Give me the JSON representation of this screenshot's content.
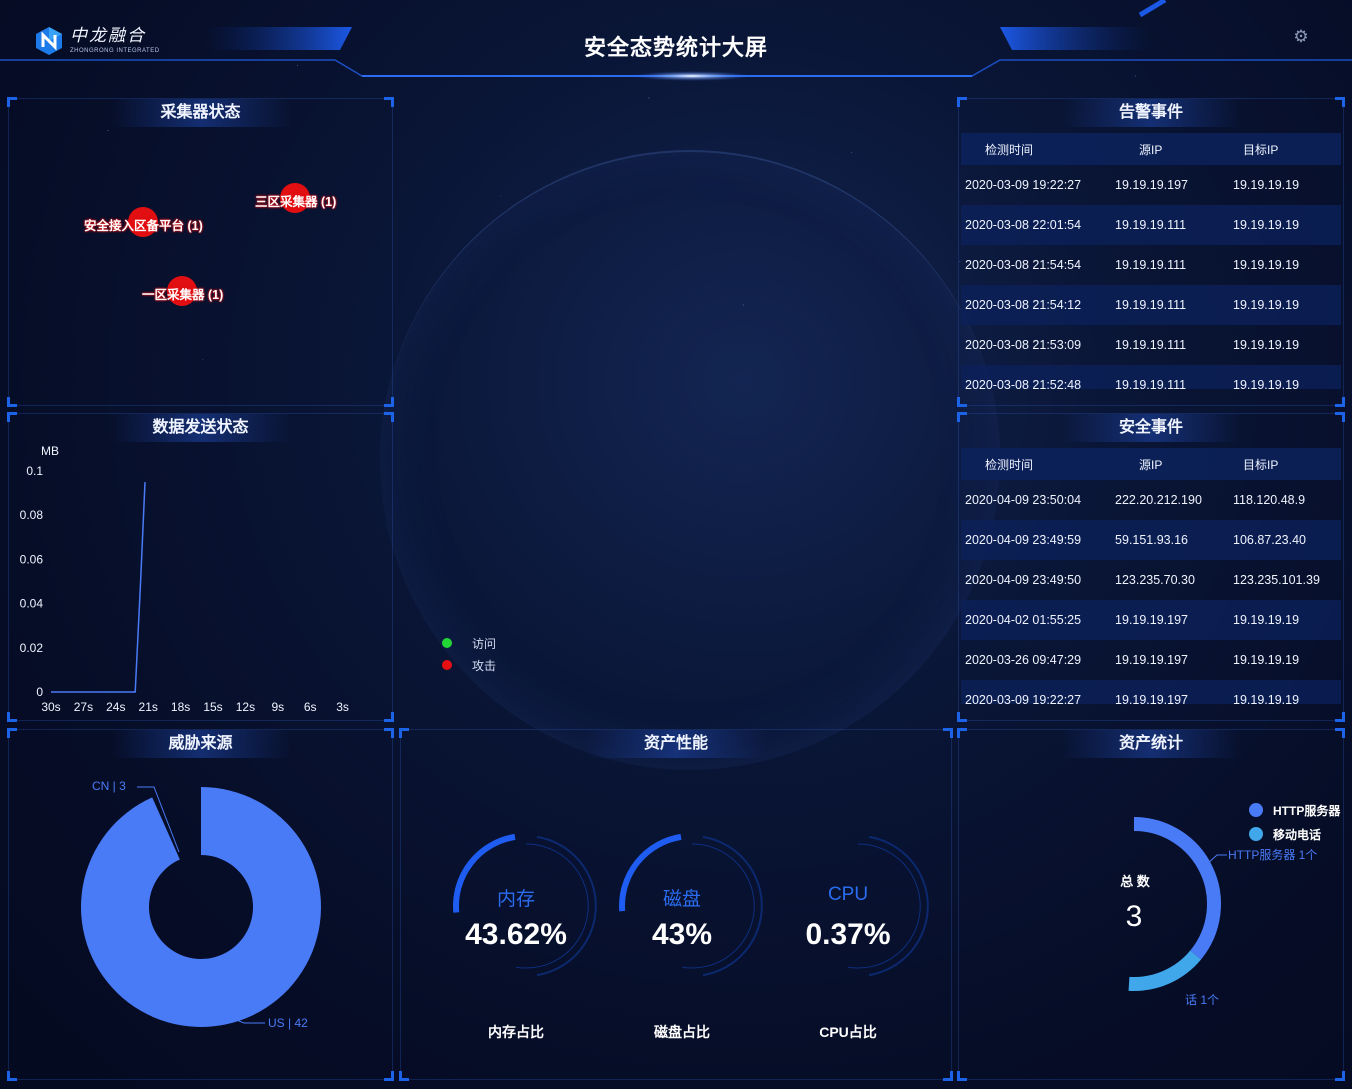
{
  "header": {
    "title": "安全态势统计大屏",
    "logo_cn": "中龙融合",
    "logo_en": "ZHONGRONG INTEGRATED",
    "settings_icon": "gear-icon"
  },
  "collector_status": {
    "title": "采集器状态",
    "nodes": [
      {
        "label": "三区采集器 (1)"
      },
      {
        "label": "安全接入区备平台 (1)"
      },
      {
        "label": "一区采集器 (1)"
      }
    ]
  },
  "data_send": {
    "title": "数据发送状态"
  },
  "chart_data": {
    "type": "line",
    "title": "数据发送状态",
    "xlabel": "",
    "ylabel": "MB",
    "ylim": [
      0,
      0.1
    ],
    "y_ticks": [
      "0.1",
      "0.08",
      "0.06",
      "0.04",
      "0.02",
      "0"
    ],
    "categories": [
      "30s",
      "27s",
      "24s",
      "21s",
      "18s",
      "15s",
      "12s",
      "9s",
      "6s",
      "3s"
    ],
    "series": [
      {
        "x": [
          30,
          27,
          24,
          22.2,
          21.7,
          21.3
        ],
        "values": [
          0,
          0,
          0,
          0,
          0.05,
          0.095
        ]
      }
    ],
    "line_color": "#4a7bf7",
    "grid": false
  },
  "map_legend": [
    {
      "label": "访问",
      "color": "#22d635"
    },
    {
      "label": "攻击",
      "color": "#e60f12"
    }
  ],
  "alarm_events": {
    "title": "告警事件",
    "columns": [
      "检测时间",
      "源IP",
      "目标IP"
    ],
    "rows": [
      [
        "2020-03-09 19:22:27",
        "19.19.19.197",
        "19.19.19.19"
      ],
      [
        "2020-03-08 22:01:54",
        "19.19.19.111",
        "19.19.19.19"
      ],
      [
        "2020-03-08 21:54:54",
        "19.19.19.111",
        "19.19.19.19"
      ],
      [
        "2020-03-08 21:54:12",
        "19.19.19.111",
        "19.19.19.19"
      ],
      [
        "2020-03-08 21:53:09",
        "19.19.19.111",
        "19.19.19.19"
      ],
      [
        "2020-03-08 21:52:48",
        "19.19.19.111",
        "19.19.19.19"
      ]
    ]
  },
  "security_events": {
    "title": "安全事件",
    "columns": [
      "检测时间",
      "源IP",
      "目标IP"
    ],
    "rows": [
      [
        "2020-04-09 23:50:04",
        "222.20.212.190",
        "118.120.48.9"
      ],
      [
        "2020-04-09 23:49:59",
        "59.151.93.16",
        "106.87.23.40"
      ],
      [
        "2020-04-09 23:49:50",
        "123.235.70.30",
        "123.235.101.39"
      ],
      [
        "2020-04-02 01:55:25",
        "19.19.19.197",
        "19.19.19.19"
      ],
      [
        "2020-03-26 09:47:29",
        "19.19.19.197",
        "19.19.19.19"
      ],
      [
        "2020-03-09 19:22:27",
        "19.19.19.197",
        "19.19.19.19"
      ]
    ]
  },
  "threat_source": {
    "title": "威胁来源",
    "slices": [
      {
        "name": "US",
        "value": 42,
        "label": "US | 42",
        "color": "#4a7bf7"
      },
      {
        "name": "CN",
        "value": 3,
        "label": "CN | 3",
        "color": "#4a7bf7"
      }
    ]
  },
  "asset_perf": {
    "title": "资产性能",
    "gauges": [
      {
        "name": "内存",
        "value_text": "43.62%",
        "value": 43.62,
        "caption": "内存占比"
      },
      {
        "name": "磁盘",
        "value_text": "43%",
        "value": 43,
        "caption": "磁盘占比"
      },
      {
        "name": "CPU",
        "value_text": "0.37%",
        "value": 0.37,
        "caption": "CPU占比"
      }
    ],
    "color": "#1f5df2"
  },
  "asset_stats": {
    "title": "资产统计",
    "total_label": "总 数",
    "total_value": "3",
    "legend": [
      {
        "label": "HTTP服务器",
        "color": "#4a7bf7"
      },
      {
        "label": "移动电话",
        "color": "#3fa7ea"
      }
    ],
    "slice_labels": {
      "http": "HTTP服务器  1个",
      "mobile": "话  1个"
    }
  }
}
